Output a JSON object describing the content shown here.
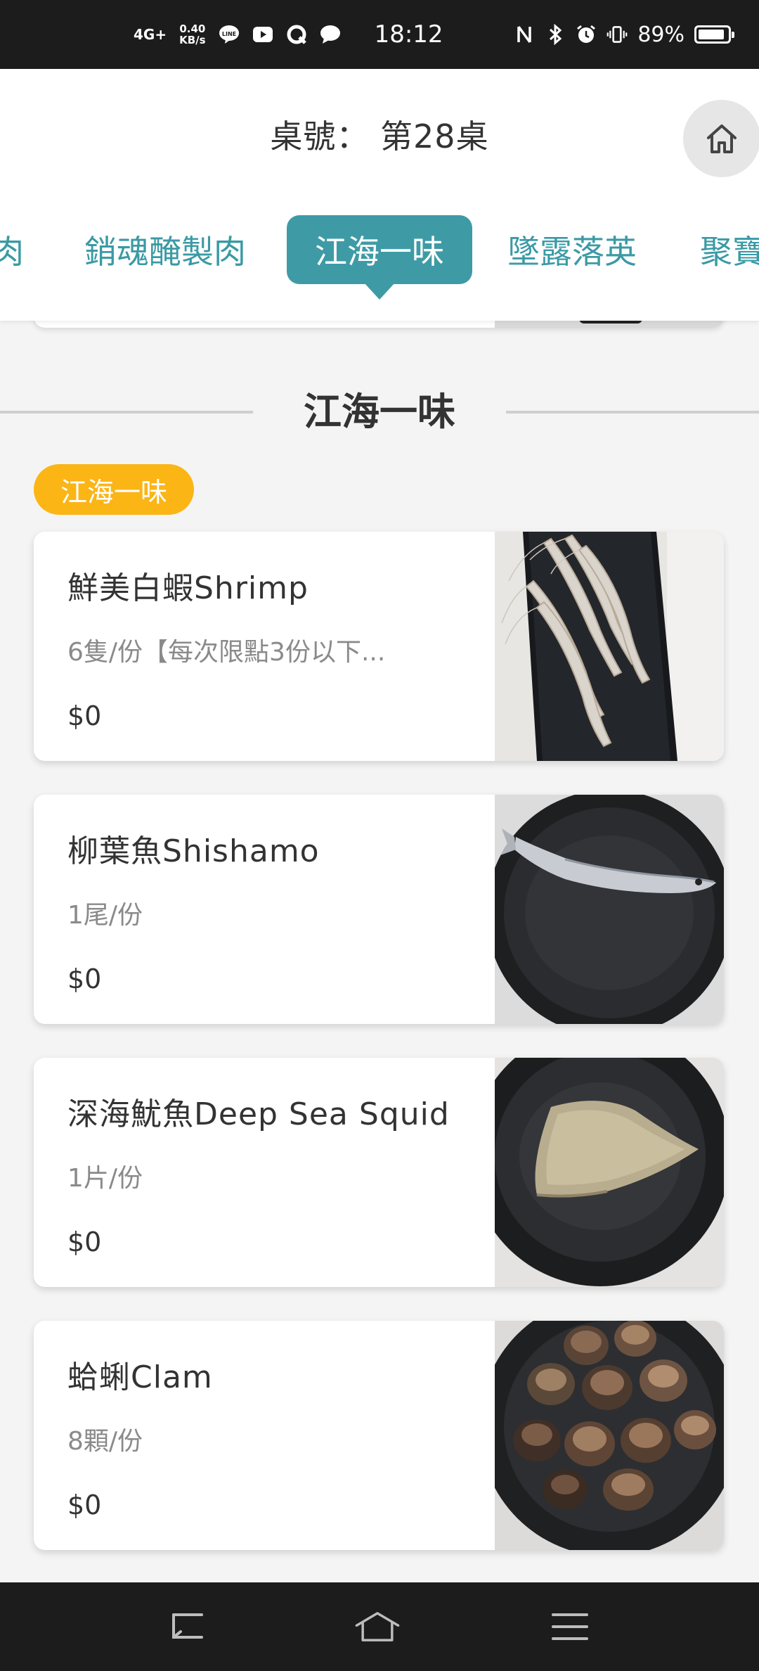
{
  "status_bar": {
    "network": "4G+",
    "speed_value": "0.40",
    "speed_unit": "KB/s",
    "line_app": "LINE",
    "time": "18:12",
    "battery": "89%",
    "battery_level": 0.89
  },
  "header": {
    "table_label": "桌號： 第28桌"
  },
  "tabs": [
    {
      "label": "肉",
      "active": false
    },
    {
      "label": "銷魂醃製肉",
      "active": false
    },
    {
      "label": "江海一味",
      "active": true
    },
    {
      "label": "墜露落英",
      "active": false
    },
    {
      "label": "聚寶",
      "active": false
    }
  ],
  "section": {
    "title": "江海一味",
    "badge": "江海一味"
  },
  "items": [
    {
      "name": "鮮美白蝦Shrimp",
      "desc": "6隻/份【每次限點3份以下...",
      "price": "$0"
    },
    {
      "name": "柳葉魚Shishamo",
      "desc": "1尾/份",
      "price": "$0"
    },
    {
      "name": "深海魷魚Deep Sea Squid",
      "desc": "1片/份",
      "price": "$0"
    },
    {
      "name": "蛤蜊Clam",
      "desc": "8顆/份",
      "price": "$0"
    }
  ],
  "colors": {
    "accent": "#3e9ba6",
    "badge": "#fbb515",
    "tab_text": "#3a9aa5"
  }
}
